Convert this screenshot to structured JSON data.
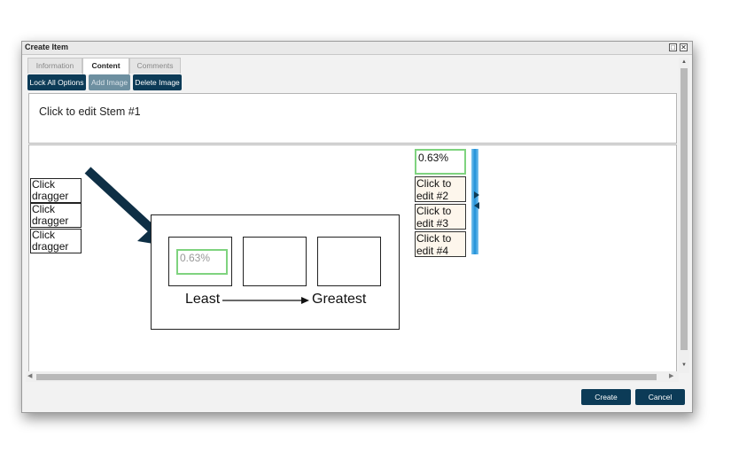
{
  "dialog": {
    "title": "Create Item",
    "window_buttons": {
      "maximize": "□",
      "close": "✕"
    }
  },
  "tabs": [
    {
      "label": "Information",
      "active": false
    },
    {
      "label": "Content",
      "active": true
    },
    {
      "label": "Comments",
      "active": false
    }
  ],
  "toolbar": {
    "lock_all_options": "Lock All Options",
    "add_image": "Add Image",
    "delete_image": "Delete Image"
  },
  "stem": {
    "text": "Click to edit Stem #1"
  },
  "draggers": [
    "Click dragger",
    "Click dragger",
    "Click dragger"
  ],
  "image": {
    "slot_value": "0.63%",
    "left_label": "Least",
    "right_label": "Greatest"
  },
  "options": [
    {
      "text": "0.63%",
      "selected": true
    },
    {
      "text": "Click to edit #2",
      "selected": false
    },
    {
      "text": "Click to edit #3",
      "selected": false
    },
    {
      "text": "Click to edit #4",
      "selected": false
    }
  ],
  "footer": {
    "create": "Create",
    "cancel": "Cancel"
  },
  "colors": {
    "button_bg": "#0c3b57",
    "disabled_bg": "#6d8fa0",
    "highlight_border": "#7fd37f",
    "arrow": "#0e2f45",
    "bar": "#1e90d8"
  },
  "icons": [
    "maximize-icon",
    "close-icon",
    "pointer-arrow-icon",
    "scroll-up-icon",
    "scroll-down-icon",
    "scroll-left-icon",
    "scroll-right-icon"
  ]
}
